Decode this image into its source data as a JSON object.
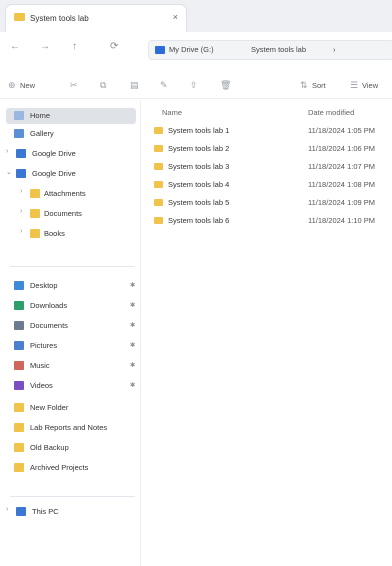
{
  "window": {
    "tab_title": "System tools lab",
    "tab_close": "×"
  },
  "nav": {
    "back": "←",
    "forward": "→",
    "up": "↑",
    "refresh": "⟳",
    "breadcrumbs": [
      "My Drive (G:)",
      "System tools lab",
      "›"
    ]
  },
  "toolbar": {
    "new_label": "New",
    "sort_label": "Sort",
    "view_label": "View"
  },
  "sidebar": {
    "items": [
      {
        "label": "Home",
        "icon": "home-icon",
        "selected": true
      },
      {
        "label": "Gallery",
        "icon": "gallery-icon"
      },
      {
        "label": "Google Drive",
        "icon": "cloud-icon"
      },
      {
        "label": "Google Drive",
        "icon": "cloud-icon"
      },
      {
        "label": "Attachments",
        "icon": "folder-icon"
      },
      {
        "label": "Documents",
        "icon": "folder-icon"
      },
      {
        "label": "Books",
        "icon": "folder-icon"
      },
      {
        "label": "Desktop",
        "icon": "desktop-icon",
        "pinned": true
      },
      {
        "label": "Downloads",
        "icon": "download-icon",
        "pinned": true
      },
      {
        "label": "Documents",
        "icon": "document-icon",
        "pinned": true
      },
      {
        "label": "Pictures",
        "icon": "pictures-icon",
        "pinned": true
      },
      {
        "label": "Music",
        "icon": "music-icon",
        "pinned": true
      },
      {
        "label": "Videos",
        "icon": "videos-icon",
        "pinned": true
      },
      {
        "label": "New Folder",
        "icon": "folder-icon"
      },
      {
        "label": "Lab Reports and Notes",
        "icon": "folder-icon"
      },
      {
        "label": "Old Backup",
        "icon": "folder-icon"
      },
      {
        "label": "Archived Projects",
        "icon": "folder-icon"
      },
      {
        "label": "This PC",
        "icon": "pc-icon"
      }
    ],
    "pin_symbol": "✱"
  },
  "content": {
    "columns": [
      "Name",
      "Date modified"
    ],
    "rows": [
      {
        "name": "System tools lab 1",
        "date": "11/18/2024 1:05 PM"
      },
      {
        "name": "System tools lab 2",
        "date": "11/18/2024 1:06 PM"
      },
      {
        "name": "System tools lab 3",
        "date": "11/18/2024 1:07 PM"
      },
      {
        "name": "System tools lab 4",
        "date": "11/18/2024 1:08 PM"
      },
      {
        "name": "System tools lab 5",
        "date": "11/18/2024 1:09 PM"
      },
      {
        "name": "System tools lab 6",
        "date": "11/18/2024 1:10 PM"
      }
    ]
  },
  "colors": {
    "folder": "#f0c34b",
    "selection": "#dfe3e8",
    "accent": "#2b6cd8"
  }
}
